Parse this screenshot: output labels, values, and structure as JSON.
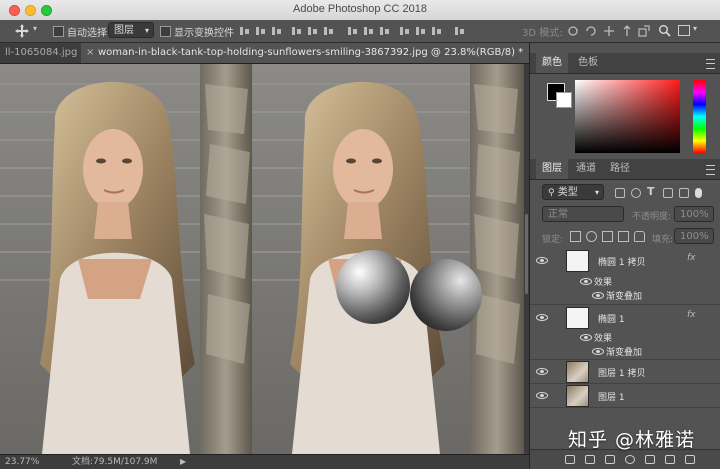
{
  "window": {
    "title": "Adobe Photoshop CC 2018"
  },
  "options_bar": {
    "move_tool_icon": "move-arrows-icon",
    "auto_select_label": "自动选择:",
    "auto_select_value": "图层",
    "show_transform_label": "显示变换控件",
    "mode_3d_label": "3D 模式:"
  },
  "document_tabs": [
    {
      "label": "ll-1065084.jpg",
      "active": false
    },
    {
      "label": "woman-in-black-tank-top-holding-sunflowers-smiling-3867392.jpg @ 23.8%(RGB/8) *",
      "active": true
    }
  ],
  "status": {
    "zoom": "23.77%",
    "doc_size": "文档:79.5M/107.9M"
  },
  "color_panel": {
    "tabs": [
      "颜色",
      "色板"
    ],
    "foreground": "#000000",
    "background": "#ffffff"
  },
  "layers_panel": {
    "tabs": [
      "图层",
      "通道",
      "路径"
    ],
    "filter_label": "类型",
    "blend_mode": "正常",
    "opacity_label": "不透明度:",
    "opacity_value": "100%",
    "lock_label": "锁定:",
    "fill_label": "填充:",
    "fill_value": "100%",
    "layers": [
      {
        "name": "椭圆 1 拷贝",
        "fx": "fx",
        "effects_label": "效果",
        "effect": "渐变叠加"
      },
      {
        "name": "椭圆 1",
        "fx": "fx",
        "effects_label": "效果",
        "effect": "渐变叠加"
      },
      {
        "name": "图层 1 拷贝"
      },
      {
        "name": "图层 1"
      }
    ]
  },
  "watermark": "知乎 @林雅诺",
  "colors": {
    "app_bg": "#535353",
    "panel_dark": "#424242",
    "titlebar": "#e0e0e0"
  }
}
